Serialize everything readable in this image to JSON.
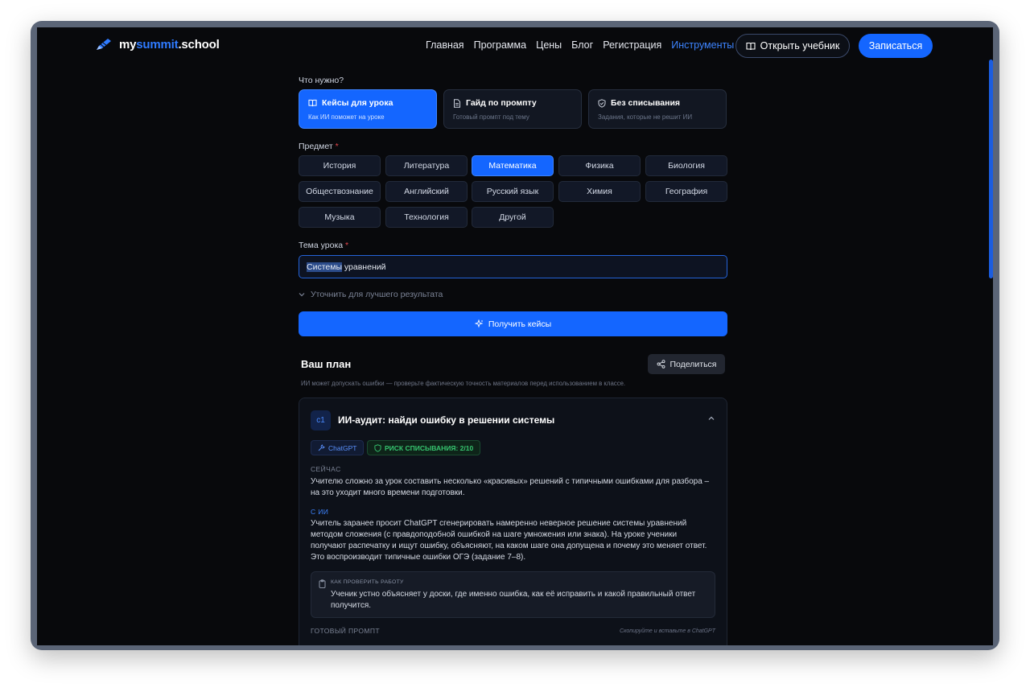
{
  "header": {
    "logo_my": "my",
    "logo_summit": "summit",
    "logo_school": ".school",
    "nav": [
      "Главная",
      "Программа",
      "Цены",
      "Блог",
      "Регистрация"
    ],
    "nav_active": "Инструменты",
    "open_textbook": "Открыть учебник",
    "enroll": "Записаться"
  },
  "form": {
    "what_needed_label": "Что нужно?",
    "types": [
      {
        "title": "Кейсы для урока",
        "subtitle": "Как ИИ поможет на уроке",
        "selected": true
      },
      {
        "title": "Гайд по промпту",
        "subtitle": "Готовый промпт под тему",
        "selected": false
      },
      {
        "title": "Без списывания",
        "subtitle": "Задания, которые не решит ИИ",
        "selected": false
      }
    ],
    "subject_label": "Предмет",
    "required_mark": "*",
    "subjects": [
      "История",
      "Литература",
      "Математика",
      "Физика",
      "Биология",
      "Обществознание",
      "Английский",
      "Русский язык",
      "Химия",
      "География",
      "Музыка",
      "Технология",
      "Другой"
    ],
    "selected_subject": "Математика",
    "topic_label": "Тема урока",
    "topic_value_highlight": "Системы",
    "topic_value_rest": " уравнений",
    "refine_label": "Уточнить для лучшего результата",
    "submit_label": "Получить кейсы"
  },
  "plan": {
    "title": "Ваш план",
    "share_label": "Поделиться",
    "disclaimer": "ИИ может допускать ошибки — проверьте фактическую точность материалов перед использованием в классе.",
    "case": {
      "number": "c1",
      "title": "ИИ-аудит: найди ошибку в решении системы",
      "tool_tag": "ChatGPT",
      "risk_tag": "РИСК СПИСЫВАНИЯ: 2/10",
      "now_label": "СЕЙЧАС",
      "now_text": "Учителю сложно за урок составить несколько «красивых» решений с типичными ошибками для разбора – на это уходит много времени подготовки.",
      "ai_label": "С ИИ",
      "ai_text": "Учитель заранее просит ChatGPT сгенерировать намеренно неверное решение системы уравнений методом сложения (с правдоподобной ошибкой на шаге умножения или знака). На уроке ученики получают распечатку и ищут ошибку, объясняют, на каком шаге она допущена и почему это меняет ответ. Это воспроизводит типичные ошибки ОГЭ (задание 7–8).",
      "check_label": "КАК ПРОВЕРИТЬ РАБОТУ",
      "check_text": "Ученик устно объясняет у доски, где именно ошибка, как её исправить и какой правильный ответ получится.",
      "prompt_label": "ГОТОВЫЙ ПРОМПТ",
      "prompt_hint": "Скопируйте и вставьте в ChatGPT"
    }
  },
  "colors": {
    "accent": "#1466ff",
    "background": "#08090c",
    "risk_green": "#36c46f",
    "required_red": "#e5484d"
  }
}
